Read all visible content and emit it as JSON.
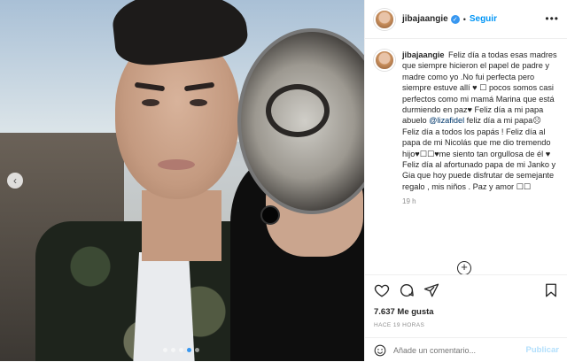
{
  "post": {
    "username": "jibajaangie",
    "verified_icon": "verified-badge-icon",
    "separator": "•",
    "follow_label": "Seguir",
    "more_label": "•••",
    "caption_user": "jibajaangie",
    "caption_part1": " Feliz día a todas esas madres que siempre hicieron el papel de padre y madre como yo .No fui perfecta pero siempre estuve allí ♥ ☐ pocos somos casi perfectos como mi mamá Marina que está durmiendo en paz♥ Feliz día a mi papa abuelo ",
    "mention": "@lizafidel",
    "caption_part2": " feliz día a mi papa☹ Feliz día a todos los papás ! Feliz día al papa de mi Nicolás que me dio tremendo hijo♥☐☐♥me siento tan orgullosa de él ♥ Feliz día al afortunado papa de mi Janko y Gia que hoy puede disfrutar de semejante regalo , mis niños . Paz y amor ☐☐",
    "caption_time": "19 h",
    "load_more_label": "+",
    "likes": "7.637 Me gusta",
    "time_ago": "HACE 19 HORAS",
    "comment_placeholder": "Añade un comentario...",
    "publish_label": "Publicar"
  },
  "colors": {
    "accent": "#0095f6",
    "publish_disabled": "#b2dffc",
    "border": "#efefef",
    "muted": "#8e8e8e"
  }
}
